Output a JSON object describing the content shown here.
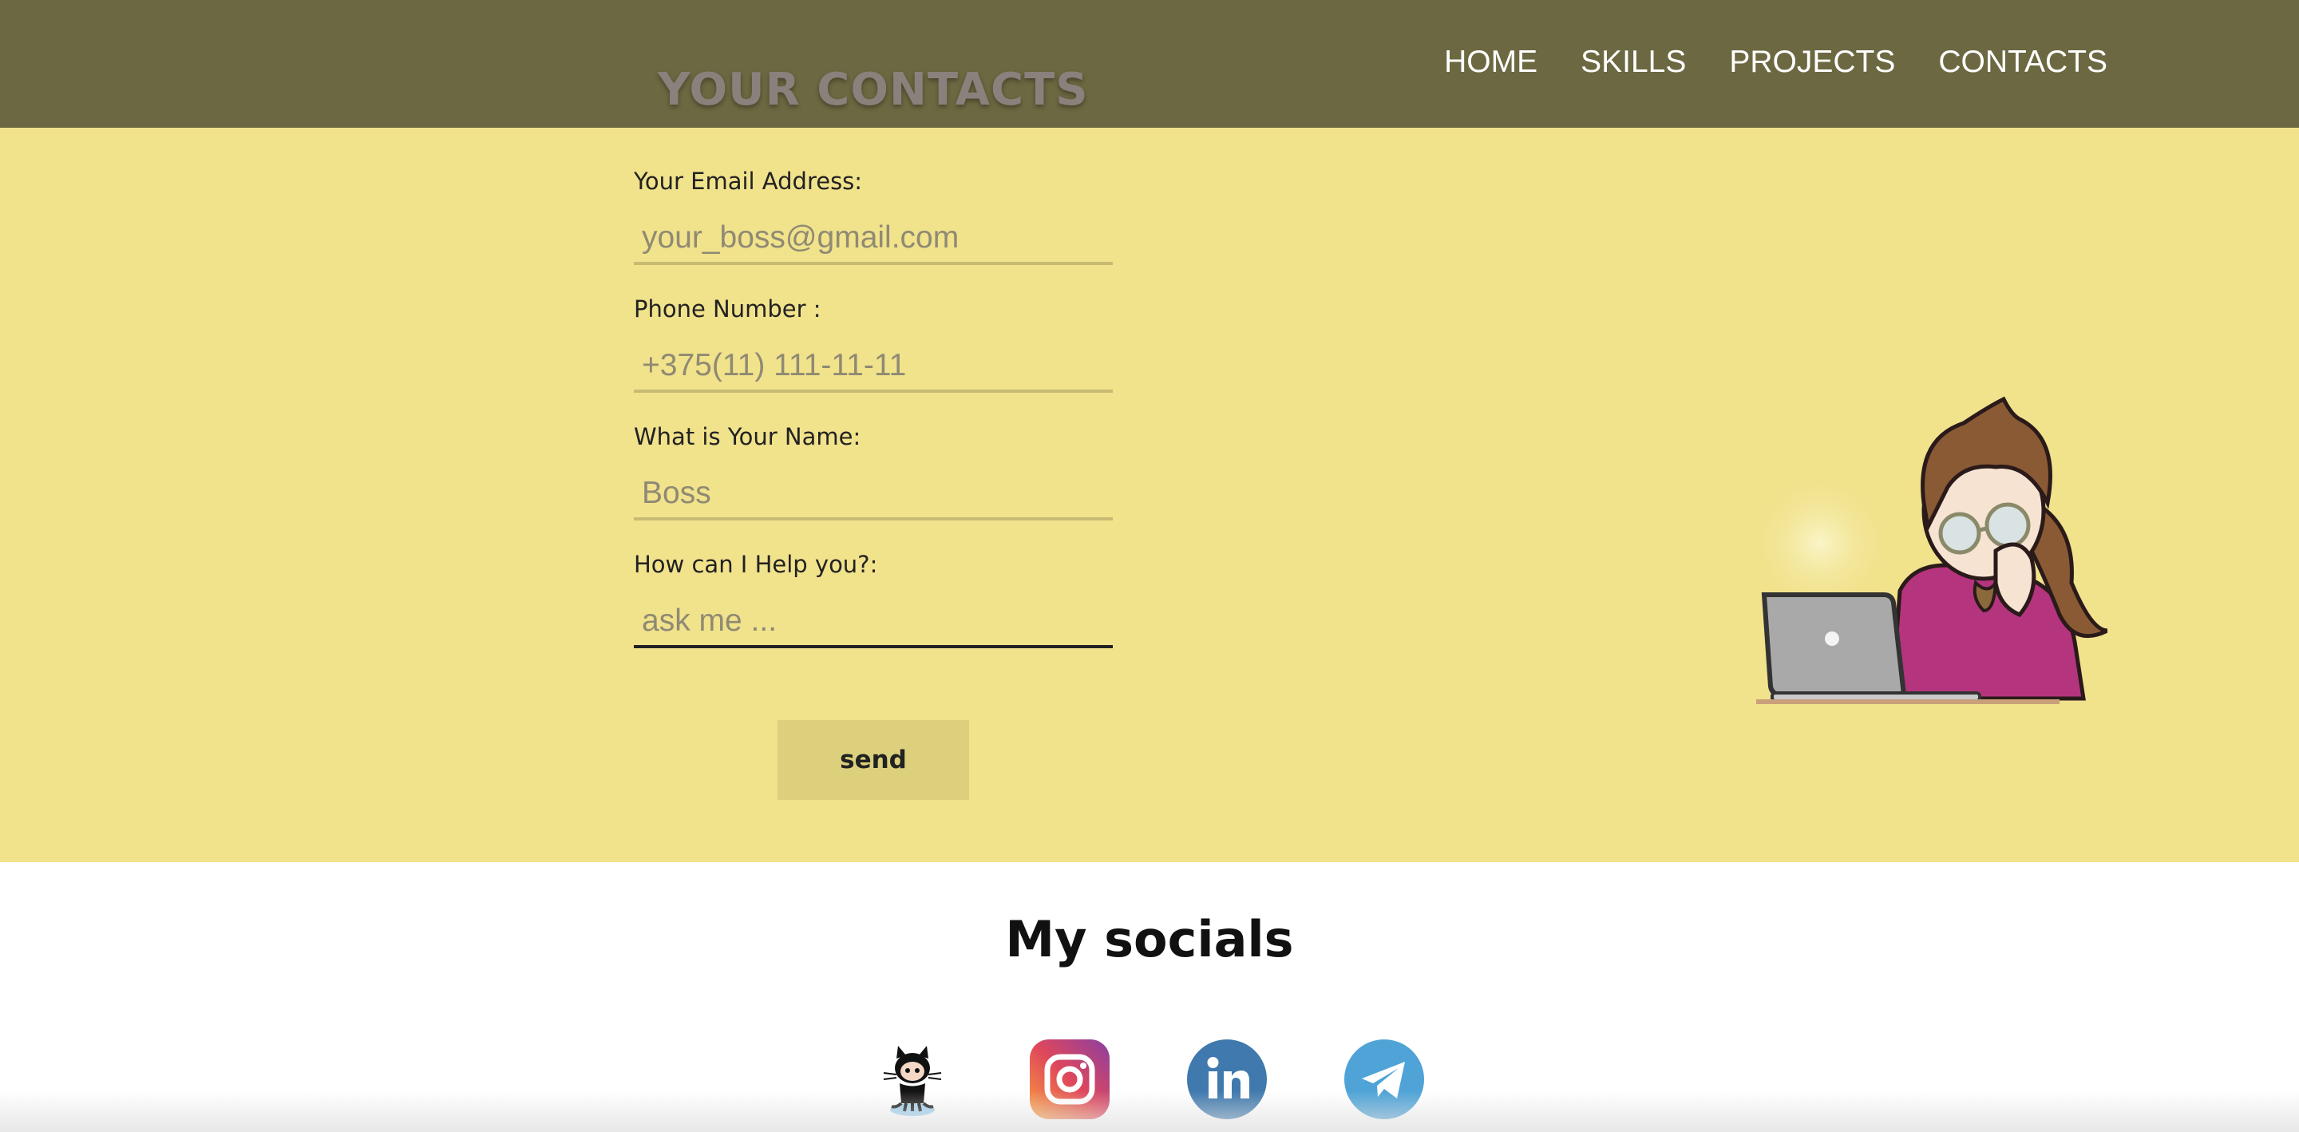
{
  "header": {
    "title": "YOUR CONTACTS",
    "nav": [
      "HOME",
      "SKILLS",
      "PROJECTS",
      "CONTACTS"
    ]
  },
  "form": {
    "email": {
      "label": "Your Email Address:",
      "placeholder": "your_boss@gmail.com"
    },
    "phone": {
      "label": "Phone Number :",
      "placeholder": "+375(11) 111-11-11"
    },
    "name": {
      "label": "What is Your Name:",
      "placeholder": "Boss"
    },
    "help": {
      "label": "How can I Help you?:",
      "placeholder": "ask me ..."
    },
    "send_label": "send"
  },
  "socials": {
    "title": "My socials",
    "items": [
      "github-icon",
      "instagram-icon",
      "linkedin-icon",
      "telegram-icon"
    ]
  },
  "colors": {
    "header_bg": "#6c6841",
    "section_bg": "#f1e28c",
    "button_bg": "#dcd07d"
  }
}
